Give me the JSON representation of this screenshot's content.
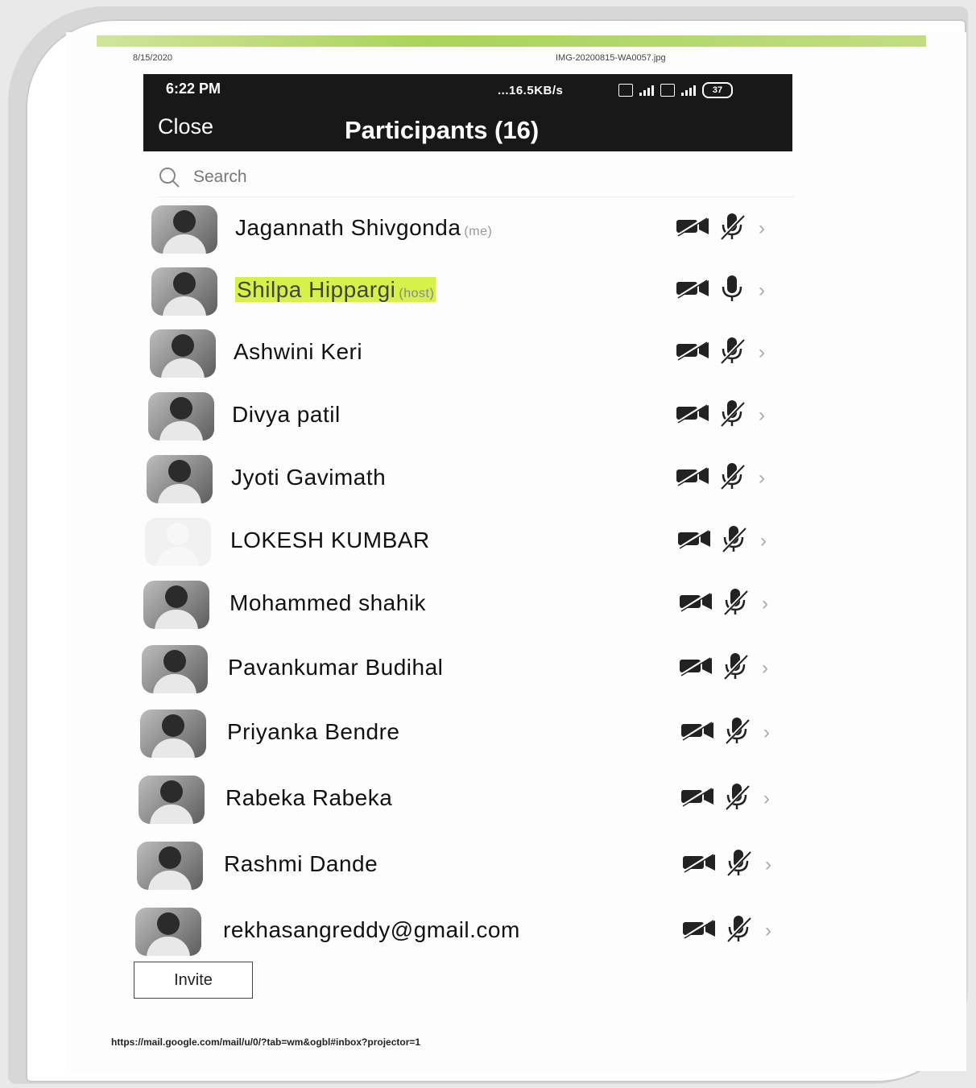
{
  "print": {
    "date": "8/15/2020",
    "filename": "IMG-20200815-WA0057.jpg",
    "footer_url": "https://mail.google.com/mail/u/0/?tab=wm&ogbl#inbox?projector=1"
  },
  "status_bar": {
    "time": "6:22 PM",
    "network_speed": "...16.5KB/s",
    "battery": "37"
  },
  "header": {
    "close_label": "Close",
    "title": "Participants (16)"
  },
  "search": {
    "placeholder": "Search"
  },
  "participants": [
    {
      "name": "Jagannath Shivgonda",
      "tag": "(me)",
      "video_icon": "video-off-icon",
      "mic_icon": "mic-muted-icon"
    },
    {
      "name": "Shilpa Hippargi",
      "tag": "(host)",
      "video_icon": "video-off-icon",
      "mic_icon": "mic-icon"
    },
    {
      "name": "Ashwini Keri",
      "tag": "",
      "video_icon": "video-off-icon",
      "mic_icon": "mic-muted-icon"
    },
    {
      "name": "Divya patil",
      "tag": "",
      "video_icon": "video-off-icon",
      "mic_icon": "mic-muted-icon"
    },
    {
      "name": "Jyoti Gavimath",
      "tag": "",
      "video_icon": "video-off-icon",
      "mic_icon": "mic-muted-icon"
    },
    {
      "name": "LOKESH KUMBAR",
      "tag": "",
      "video_icon": "video-off-icon",
      "mic_icon": "mic-muted-icon"
    },
    {
      "name": "Mohammed shahik",
      "tag": "",
      "video_icon": "video-off-icon",
      "mic_icon": "mic-muted-icon"
    },
    {
      "name": "Pavankumar Budihal",
      "tag": "",
      "video_icon": "video-off-icon",
      "mic_icon": "mic-muted-icon"
    },
    {
      "name": "Priyanka Bendre",
      "tag": "",
      "video_icon": "video-off-icon",
      "mic_icon": "mic-muted-icon"
    },
    {
      "name": "Rabeka Rabeka",
      "tag": "",
      "video_icon": "video-off-icon",
      "mic_icon": "mic-muted-icon"
    },
    {
      "name": "Rashmi Dande",
      "tag": "",
      "video_icon": "video-off-icon",
      "mic_icon": "mic-muted-icon"
    },
    {
      "name": "rekhasangreddy@gmail.com",
      "tag": "",
      "video_icon": "video-off-icon",
      "mic_icon": "mic-muted-icon"
    }
  ],
  "footer": {
    "invite_label": "Invite"
  },
  "colors": {
    "topbar_bg": "#181818",
    "host_highlight": "#d6f24a",
    "frame": "#d7d7d7"
  }
}
